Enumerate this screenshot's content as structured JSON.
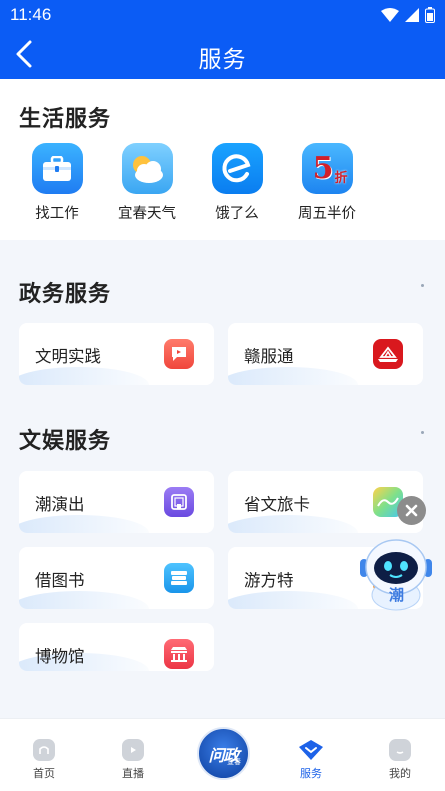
{
  "status_bar": {
    "time": "11:46"
  },
  "header": {
    "title": "服务"
  },
  "life_services": {
    "title": "生活服务",
    "items": [
      {
        "label": "找工作",
        "icon": "briefcase-icon"
      },
      {
        "label": "宜春天气",
        "icon": "weather-icon"
      },
      {
        "label": "饿了么",
        "icon": "eleme-icon"
      },
      {
        "label": "周五半价",
        "icon": "friday-half-price-icon",
        "badge_num": "5",
        "badge_text": "折"
      }
    ]
  },
  "gov_services": {
    "title": "政务服务",
    "items": [
      {
        "label": "文明实践",
        "icon": "flag-icon",
        "color": "#f0564a"
      },
      {
        "label": "赣服通",
        "icon": "ganfutong-icon",
        "color": "#d9181e"
      }
    ]
  },
  "ent_services": {
    "title": "文娱服务",
    "items": [
      {
        "label": "潮演出",
        "icon": "stage-icon",
        "color": "#7d5be8"
      },
      {
        "label": "省文旅卡",
        "icon": "travel-card-icon",
        "color": "#5ad07f"
      },
      {
        "label": "借图书",
        "icon": "books-icon",
        "color": "#27a8f0"
      },
      {
        "label": "游方特",
        "icon": "fangte-icon",
        "color": "#f3a640"
      },
      {
        "label": "博物馆",
        "icon": "museum-icon",
        "color": "#f04a56"
      }
    ]
  },
  "robot": {
    "label": "潮"
  },
  "bottom_nav": {
    "items": [
      {
        "label": "首页",
        "icon": "home-icon"
      },
      {
        "label": "直播",
        "icon": "live-icon"
      },
      {
        "label": "服务",
        "icon": "service-icon",
        "active": true
      },
      {
        "label": "我的",
        "icon": "profile-icon"
      }
    ],
    "center_text": "问政",
    "center_subtext": "宜春"
  }
}
